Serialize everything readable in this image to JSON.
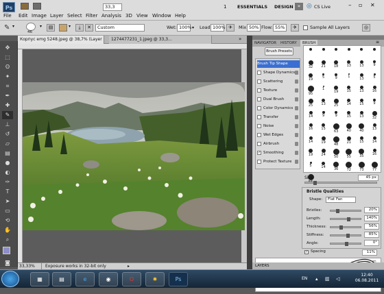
{
  "app": {
    "logo": "Ps",
    "zoom_select": "33,3",
    "workspace_num": "1",
    "workspace": "ESSENTIALS",
    "design": "DESIGN",
    "cslive": "CS Live"
  },
  "menu": [
    "File",
    "Edit",
    "Image",
    "Layer",
    "Select",
    "Filter",
    "Analysis",
    "3D",
    "View",
    "Window",
    "Help"
  ],
  "options": {
    "brush_size": "46",
    "mode_label": "Custom",
    "wet_label": "Wet:",
    "wet_value": "100%",
    "load_label": "Load:",
    "load_value": "100%",
    "mix_label": "Mix:",
    "mix_value": "50%",
    "flow_label": "Flow:",
    "flow_value": "55%",
    "sample_all_layers": "Sample All Layers"
  },
  "tabs": [
    "Корпус emg 5248.jpeg @ 38,7% (Layer 0 copy, RGB/8#)",
    "1274477231_1.jpeg @ 33,3..."
  ],
  "status": {
    "zoom": "33,33%",
    "message": "Exposure works in 32-bit only"
  },
  "panel_tabs": [
    "NAVIGATOR",
    "HISTORY",
    "BRUSH"
  ],
  "brush": {
    "presets_button": "Brush Presets",
    "categories": [
      {
        "label": "Brush Tip Shape",
        "checked": false,
        "selected": true
      },
      {
        "label": "Shape Dynamics",
        "checked": false
      },
      {
        "label": "Scattering",
        "checked": false
      },
      {
        "label": "Texture",
        "checked": false
      },
      {
        "label": "Dual Brush",
        "checked": false
      },
      {
        "label": "Color Dynamics",
        "checked": false
      },
      {
        "label": "Transfer",
        "checked": false
      },
      {
        "label": "Noise",
        "checked": false
      },
      {
        "label": "Wet Edges",
        "checked": false
      },
      {
        "label": "Airbrush",
        "checked": false
      },
      {
        "label": "Smoothing",
        "checked": true
      },
      {
        "label": "Protect Texture",
        "checked": false
      }
    ],
    "tips": [
      "",
      "",
      "",
      "",
      "",
      "",
      "32",
      "21",
      "18",
      "13",
      "13",
      "9",
      "19",
      "5",
      "9",
      "1",
      "13",
      "5",
      "95",
      "1",
      "19",
      "15",
      "13",
      "16",
      "25",
      "13",
      "25",
      "14",
      "15",
      "9",
      "14",
      "9",
      "9",
      "15",
      "13",
      "32",
      "16",
      "15",
      "63",
      "40",
      "40",
      "13",
      "14",
      "19",
      "48",
      "21",
      "15",
      "14",
      "19",
      "24",
      "50",
      "55",
      "35",
      "16",
      "5",
      "14",
      "36",
      "72",
      "73",
      "77",
      "56"
    ],
    "size_label": "Size",
    "size_value": "45 px",
    "bristle_title": "Bristle Qualities",
    "shape_label": "Shape:",
    "shape_value": "Flat Fan",
    "rows": [
      {
        "label": "Bristles:",
        "value": "20%",
        "pos": 0.2
      },
      {
        "label": "Length:",
        "value": "140%",
        "pos": 0.56
      },
      {
        "label": "Thickness:",
        "value": "56%",
        "pos": 0.3
      },
      {
        "label": "Stiffness:",
        "value": "85%",
        "pos": 0.55
      },
      {
        "label": "Angle:",
        "value": "0°",
        "pos": 0.5
      }
    ],
    "spacing_label": "Spacing",
    "spacing_value": "11%"
  },
  "layers_label": "LAYERS",
  "taskbar": {
    "lang": "EN",
    "time": "12:40",
    "date": "06.08.2011"
  }
}
